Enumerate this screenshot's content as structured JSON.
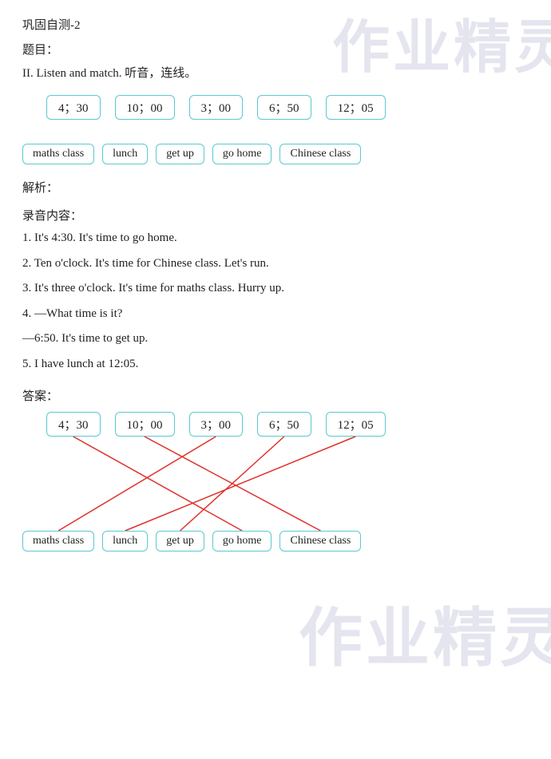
{
  "watermark_top": "作业精灵",
  "watermark_bottom": "作业精灵",
  "header": {
    "title": "巩固自测-2",
    "topic_label": "题目："
  },
  "instruction": "II. Listen and match. 听音，连线。",
  "times": [
    "4；30",
    "10；00",
    "3；00",
    "6；50",
    "12；05"
  ],
  "labels": [
    "maths class",
    "lunch",
    "get up",
    "go home",
    "Chinese class"
  ],
  "analysis": {
    "label": "解析：",
    "recording_label": "录音内容：",
    "lines": [
      "1. It's 4:30. It's time to go home.",
      "2. Ten o'clock. It's time for Chinese class. Let's run.",
      "3. It's three o'clock. It's time for maths class. Hurry up.",
      "4. —What time is it?",
      "—6:50. It's time to get up.",
      "5. I have lunch at 12:05."
    ]
  },
  "answer": {
    "label": "答案：",
    "times": [
      "4；30",
      "10；00",
      "3；00",
      "6；50",
      "12；05"
    ],
    "labels": [
      "maths class",
      "lunch",
      "get up",
      "go home",
      "Chinese class"
    ]
  }
}
